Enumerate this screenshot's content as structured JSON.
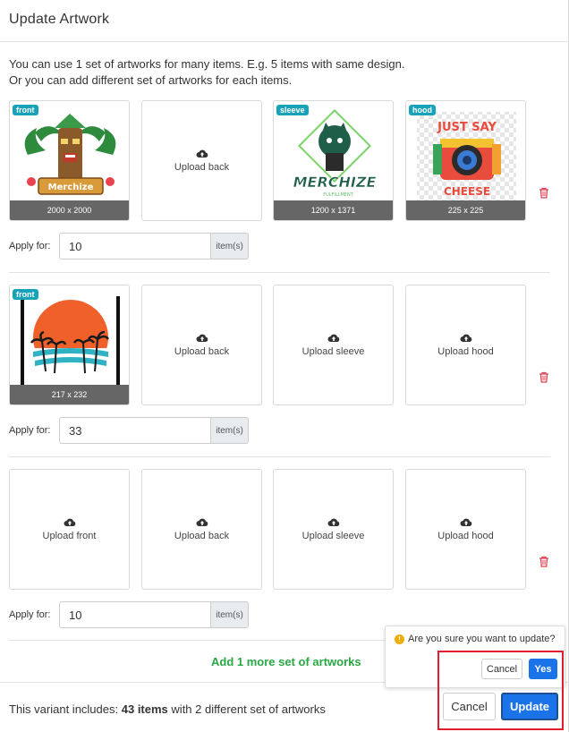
{
  "modal": {
    "title": "Update Artwork",
    "intro_line1": "You can use 1 set of artworks for many items. E.g. 5 items with same design.",
    "intro_line2": "Or you can add different set of artworks for each items."
  },
  "sets": [
    {
      "tiles": [
        {
          "type": "artwork",
          "badge": "front",
          "dimensions": "2000 x 2000",
          "art_text": "Merchize"
        },
        {
          "type": "upload",
          "label": "Upload back"
        },
        {
          "type": "artwork",
          "badge": "sleeve",
          "dimensions": "1200 x 1371",
          "art_text": "MERCHIZE",
          "art_subtext": "FULFILLMENT"
        },
        {
          "type": "artwork",
          "badge": "hood",
          "dimensions": "225 x 225",
          "art_text": "JUST SAY",
          "art_subtext": "CHEESE"
        }
      ],
      "apply_label": "Apply for:",
      "apply_value": "10",
      "apply_unit": "item(s)"
    },
    {
      "tiles": [
        {
          "type": "artwork",
          "badge": "front",
          "dimensions": "217 x 232"
        },
        {
          "type": "upload",
          "label": "Upload back"
        },
        {
          "type": "upload",
          "label": "Upload sleeve"
        },
        {
          "type": "upload",
          "label": "Upload hood"
        }
      ],
      "apply_label": "Apply for:",
      "apply_value": "33",
      "apply_unit": "item(s)"
    },
    {
      "tiles": [
        {
          "type": "upload",
          "label": "Upload front"
        },
        {
          "type": "upload",
          "label": "Upload back"
        },
        {
          "type": "upload",
          "label": "Upload sleeve"
        },
        {
          "type": "upload",
          "label": "Upload hood"
        }
      ],
      "apply_label": "Apply for:",
      "apply_value": "10",
      "apply_unit": "item(s)"
    }
  ],
  "add_more_label": "Add 1 more set of artworks",
  "footer": {
    "summary_prefix": "This variant includes:",
    "summary_items": "43 items",
    "summary_suffix": "with 2 different set of artworks",
    "cancel_label": "Cancel",
    "update_label": "Update"
  },
  "confirm": {
    "message": "Are you sure you want to update?",
    "cancel_label": "Cancel",
    "yes_label": "Yes"
  },
  "colors": {
    "badge": "#17a2b8",
    "primary": "#1a73e8",
    "add_more": "#28a745",
    "delete": "#e04050",
    "highlight": "#e01e2e",
    "warning": "#f0ad00"
  },
  "icons": {
    "upload": "cloud-upload-icon",
    "delete": "trash-icon",
    "warning": "exclamation-circle-icon"
  }
}
